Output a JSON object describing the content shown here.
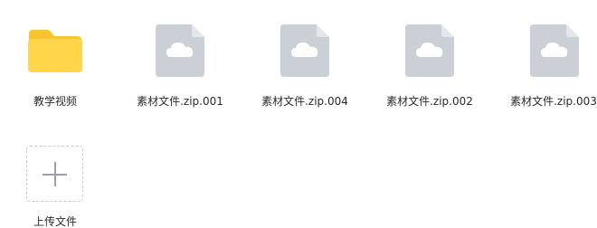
{
  "items": [
    {
      "name": "教学视频",
      "type": "folder",
      "icon": "folder-icon"
    },
    {
      "name": "素材文件.zip.001",
      "type": "file",
      "icon": "cloud-file-icon"
    },
    {
      "name": "素材文件.zip.004",
      "type": "file",
      "icon": "cloud-file-icon"
    },
    {
      "name": "素材文件.zip.002",
      "type": "file",
      "icon": "cloud-file-icon"
    },
    {
      "name": "素材文件.zip.003",
      "type": "file",
      "icon": "cloud-file-icon"
    }
  ],
  "upload": {
    "label": "上传文件",
    "icon": "plus-icon"
  },
  "colors": {
    "folder": "#FFD54A",
    "folder_tab": "#F7C62F",
    "file_icon": "#CBCFD6",
    "file_fold": "#E3E6EA",
    "cloud": "#FFFFFF",
    "upload_border": "#C8CCD3",
    "plus": "#9AA0A8"
  }
}
